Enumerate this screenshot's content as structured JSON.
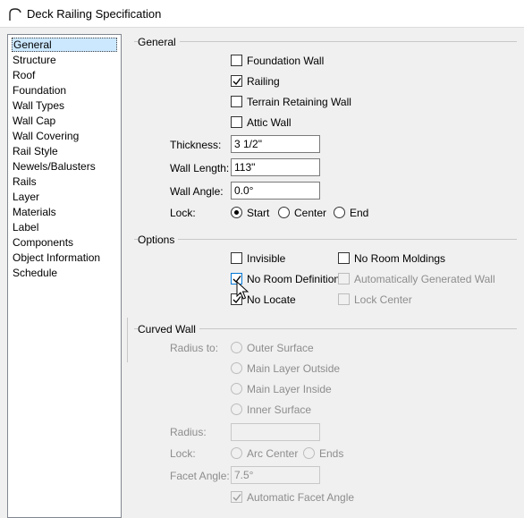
{
  "window": {
    "title": "Deck Railing Specification",
    "icon": "railing-icon"
  },
  "sidebar": {
    "items": [
      {
        "label": "General",
        "selected": true
      },
      {
        "label": "Structure"
      },
      {
        "label": "Roof"
      },
      {
        "label": "Foundation"
      },
      {
        "label": "Wall Types"
      },
      {
        "label": "Wall Cap"
      },
      {
        "label": "Wall Covering"
      },
      {
        "label": "Rail Style"
      },
      {
        "label": "Newels/Balusters"
      },
      {
        "label": "Rails"
      },
      {
        "label": "Layer"
      },
      {
        "label": "Materials"
      },
      {
        "label": "Label"
      },
      {
        "label": "Components"
      },
      {
        "label": "Object Information"
      },
      {
        "label": "Schedule"
      }
    ]
  },
  "general": {
    "title": "General",
    "foundation_wall": {
      "label": "Foundation Wall",
      "checked": false
    },
    "railing": {
      "label": "Railing",
      "checked": true
    },
    "terrain_retaining_wall": {
      "label": "Terrain Retaining Wall",
      "checked": false
    },
    "attic_wall": {
      "label": "Attic Wall",
      "checked": false
    },
    "thickness": {
      "label": "Thickness:",
      "value": "3 1/2\""
    },
    "wall_length": {
      "label": "Wall Length:",
      "value": "113\""
    },
    "wall_angle": {
      "label": "Wall Angle:",
      "value": "0.0°"
    },
    "lock": {
      "label": "Lock:",
      "options": [
        "Start",
        "Center",
        "End"
      ],
      "selected": "Start"
    }
  },
  "options": {
    "title": "Options",
    "invisible": {
      "label": "Invisible",
      "checked": false
    },
    "no_room_moldings": {
      "label": "No Room Moldings",
      "checked": false
    },
    "no_room_definition": {
      "label": "No Room Definition",
      "checked": true
    },
    "auto_generated_wall": {
      "label": "Automatically Generated Wall",
      "checked": false,
      "disabled": true
    },
    "no_locate": {
      "label": "No Locate",
      "checked": true
    },
    "lock_center": {
      "label": "Lock Center",
      "checked": false,
      "disabled": true
    }
  },
  "curved_wall": {
    "title": "Curved Wall",
    "radius_to_label": "Radius to:",
    "radius_to_options": [
      "Outer Surface",
      "Main Layer Outside",
      "Main Layer Inside",
      "Inner Surface"
    ],
    "radius_label": "Radius:",
    "radius_value": "",
    "lock_label": "Lock:",
    "lock_options": [
      "Arc Center",
      "Ends"
    ],
    "facet_angle_label": "Facet Angle:",
    "facet_angle_value": "7.5°",
    "auto_facet": {
      "label": "Automatic Facet Angle",
      "checked": true,
      "disabled": true
    }
  }
}
